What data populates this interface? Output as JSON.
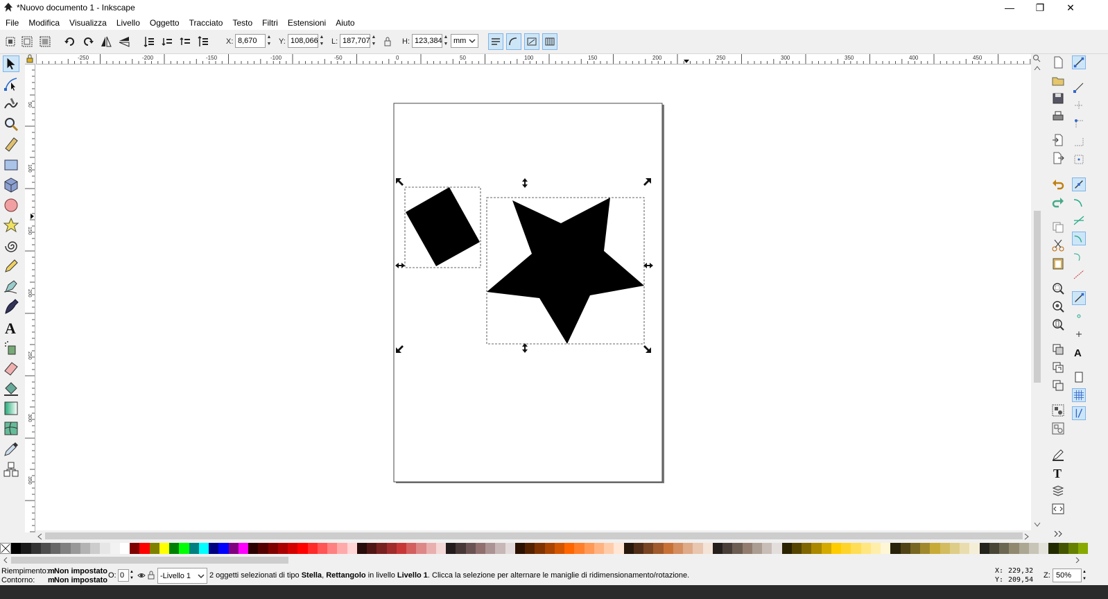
{
  "window": {
    "title": "*Nuovo documento 1 - Inkscape",
    "minimize": "—",
    "maximize": "❐",
    "close": "✕"
  },
  "menu": [
    "File",
    "Modifica",
    "Visualizza",
    "Livello",
    "Oggetto",
    "Tracciato",
    "Testo",
    "Filtri",
    "Estensioni",
    "Aiuto"
  ],
  "toolbar": {
    "x_label": "X:",
    "x_value": "8,670",
    "y_label": "Y:",
    "y_value": "108,066",
    "w_label": "L:",
    "w_value": "187,707",
    "h_label": "H:",
    "h_value": "123,384",
    "unit": "mm"
  },
  "ruler_top_labels": [
    "-250",
    "-200",
    "-150",
    "-100",
    "-50",
    "0",
    "50",
    "100",
    "150",
    "200",
    "250",
    "300",
    "350",
    "400",
    "450"
  ],
  "ruler_left_labels": [
    "50",
    "100",
    "150",
    "200",
    "250",
    "300",
    "350",
    "400",
    "450",
    "500"
  ],
  "palette": [
    "#000000",
    "#1a1a1a",
    "#333333",
    "#4d4d4d",
    "#666666",
    "#808080",
    "#999999",
    "#b3b3b3",
    "#cccccc",
    "#e6e6e6",
    "#f2f2f2",
    "#ffffff",
    "#800000",
    "#ff0000",
    "#808000",
    "#ffff00",
    "#008000",
    "#00ff00",
    "#008080",
    "#00ffff",
    "#000080",
    "#0000ff",
    "#800080",
    "#ff00ff",
    "#2b0000",
    "#550000",
    "#800000",
    "#aa0000",
    "#d40000",
    "#ff0000",
    "#ff2a2a",
    "#ff5555",
    "#ff8080",
    "#ffaaaa",
    "#ffd5d5",
    "#280b0b",
    "#501616",
    "#782121",
    "#a02c2c",
    "#c83737",
    "#d35f5f",
    "#de8787",
    "#e9afaf",
    "#f4d7d7",
    "#241c1c",
    "#483737",
    "#6c5353",
    "#916f6f",
    "#ac9393",
    "#c8b7b7",
    "#e3dbdb",
    "#2b1100",
    "#552200",
    "#803300",
    "#aa4400",
    "#d45500",
    "#ff6600",
    "#ff7f2a",
    "#ff9955",
    "#ffb380",
    "#ffccaa",
    "#ffe6d5",
    "#28170b",
    "#502d16",
    "#784421",
    "#a05a2c",
    "#c87137",
    "#d38d5f",
    "#deaa87",
    "#e9c6af",
    "#f4e3d7",
    "#241f1c",
    "#483e37",
    "#6c5d53",
    "#917c6f",
    "#ac9d93",
    "#c8beb7",
    "#e3dedb",
    "#2b2200",
    "#554400",
    "#806600",
    "#aa8800",
    "#d4aa00",
    "#ffcc00",
    "#ffd42a",
    "#ffdd55",
    "#ffe680",
    "#ffeeaa",
    "#fff6d5",
    "#28220b",
    "#504416",
    "#786721",
    "#a0892c",
    "#c8ab37",
    "#d3bc5f",
    "#decd87",
    "#e9ddaf",
    "#f4eed7",
    "#24221c",
    "#484537",
    "#6c6753",
    "#91896f",
    "#aca793",
    "#c8c4b7",
    "#e3e2db",
    "#222b00",
    "#445500",
    "#668000",
    "#88aa00"
  ],
  "status": {
    "fill_label": "Riempimento:",
    "fill_value": "Non impostato",
    "fill_swatch": "m",
    "stroke_label": "Contorno:",
    "stroke_value": "Non impostato",
    "stroke_swatch": "m",
    "opacity_label": "O:",
    "opacity_value": "0",
    "layer": "-Livello 1",
    "msg_1": "2 oggetti selezionati di tipo ",
    "msg_stella": "Stella",
    "msg_2": ", ",
    "msg_rett": "Rettangolo",
    "msg_3": " in livello ",
    "msg_livello": "Livello 1",
    "msg_4": ". Clicca la selezione per alternare le maniglie di ridimensionamento/rotazione.",
    "cx_label": "X:",
    "cx_value": "229,32",
    "cy_label": "Y:",
    "cy_value": "209,54",
    "zoom_label": "Z:",
    "zoom_value": "50%"
  }
}
